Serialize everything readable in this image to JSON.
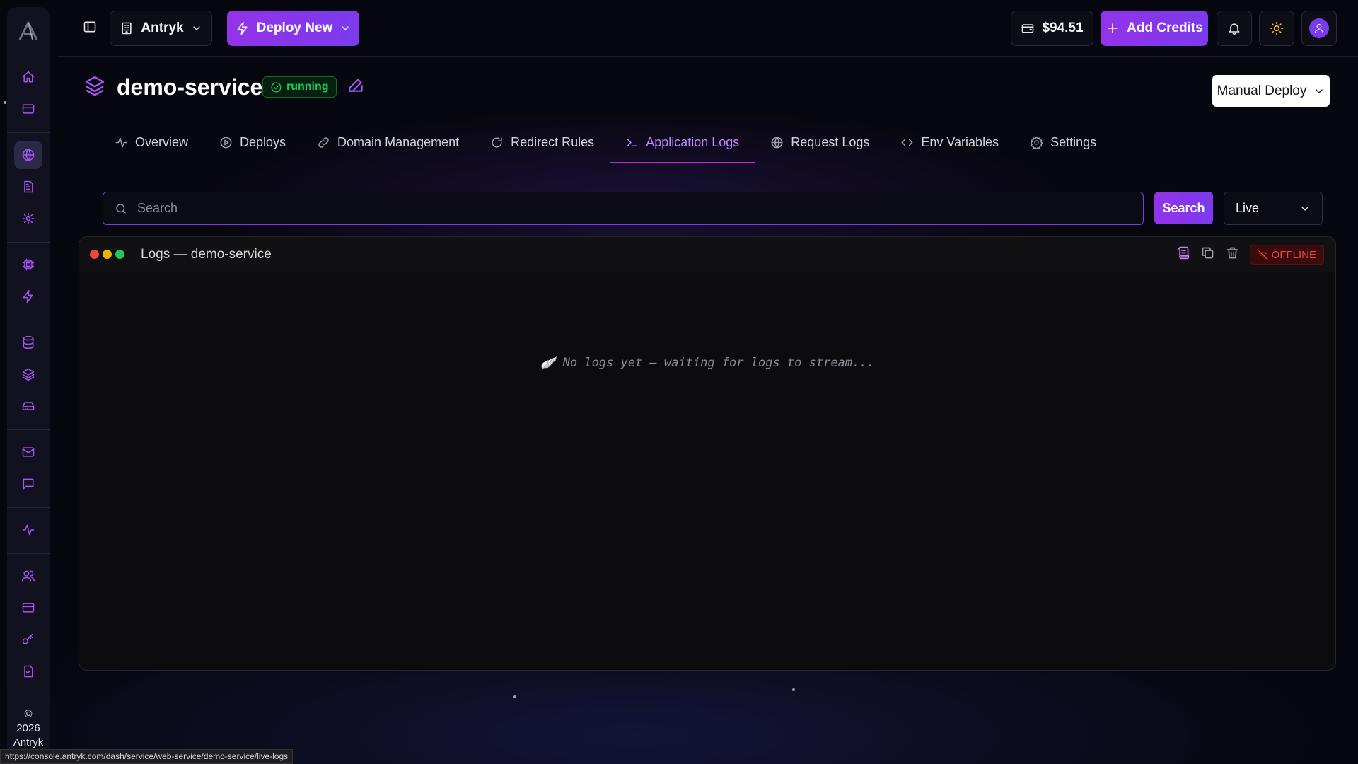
{
  "topbar": {
    "org_name": "Antryk",
    "deploy_new_label": "Deploy New",
    "balance": "$94.51",
    "add_credits_label": "Add Credits"
  },
  "service": {
    "name": "demo-service",
    "status": "running",
    "manual_deploy_label": "Manual Deploy"
  },
  "tabs": [
    {
      "label": "Overview",
      "icon": "activity-icon"
    },
    {
      "label": "Deploys",
      "icon": "play-circle-icon"
    },
    {
      "label": "Domain Management",
      "icon": "link-icon"
    },
    {
      "label": "Redirect Rules",
      "icon": "refresh-icon"
    },
    {
      "label": "Application Logs",
      "icon": "terminal-icon",
      "active": true
    },
    {
      "label": "Request Logs",
      "icon": "globe-icon"
    },
    {
      "label": "Env Variables",
      "icon": "code-icon"
    },
    {
      "label": "Settings",
      "icon": "gear-icon"
    }
  ],
  "search": {
    "placeholder": "Search",
    "button_label": "Search",
    "mode_selected": "Live"
  },
  "logs": {
    "title": "Logs — demo-service",
    "connection_status": "OFFLINE",
    "empty_message": "🪽 No logs yet — waiting for logs to stream..."
  },
  "sidebar": {
    "footer_copyright": "©",
    "footer_year": "2026",
    "footer_brand": "Antryk"
  },
  "status_bar_url": "https://console.antryk.com/dash/service/web-service/demo-service/live-logs",
  "colors": {
    "accent": "#9333ea",
    "running": "#22c55e",
    "offline": "#ef4444"
  }
}
